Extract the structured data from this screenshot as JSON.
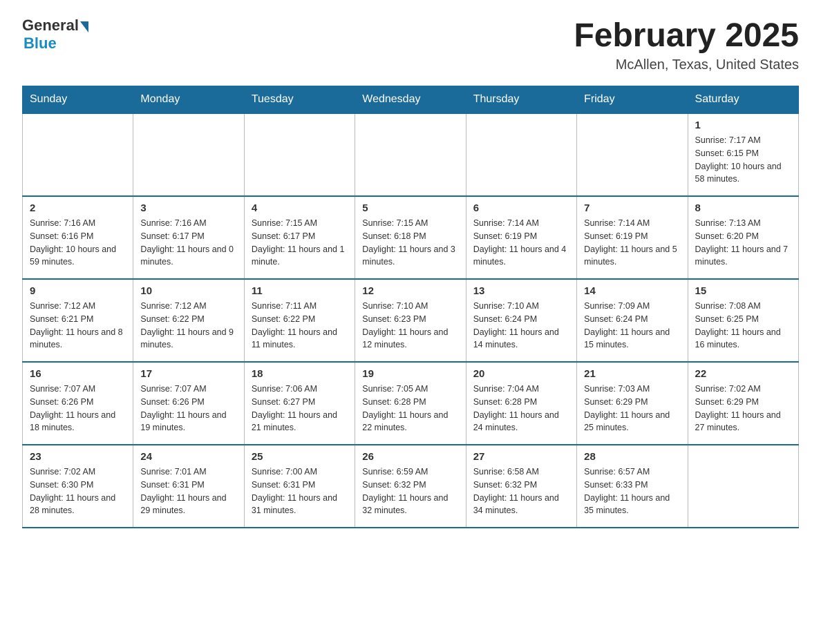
{
  "header": {
    "logo_general": "General",
    "logo_blue": "Blue",
    "title": "February 2025",
    "location": "McAllen, Texas, United States"
  },
  "weekdays": [
    "Sunday",
    "Monday",
    "Tuesday",
    "Wednesday",
    "Thursday",
    "Friday",
    "Saturday"
  ],
  "weeks": [
    [
      {
        "day": "",
        "info": ""
      },
      {
        "day": "",
        "info": ""
      },
      {
        "day": "",
        "info": ""
      },
      {
        "day": "",
        "info": ""
      },
      {
        "day": "",
        "info": ""
      },
      {
        "day": "",
        "info": ""
      },
      {
        "day": "1",
        "info": "Sunrise: 7:17 AM\nSunset: 6:15 PM\nDaylight: 10 hours and 58 minutes."
      }
    ],
    [
      {
        "day": "2",
        "info": "Sunrise: 7:16 AM\nSunset: 6:16 PM\nDaylight: 10 hours and 59 minutes."
      },
      {
        "day": "3",
        "info": "Sunrise: 7:16 AM\nSunset: 6:17 PM\nDaylight: 11 hours and 0 minutes."
      },
      {
        "day": "4",
        "info": "Sunrise: 7:15 AM\nSunset: 6:17 PM\nDaylight: 11 hours and 1 minute."
      },
      {
        "day": "5",
        "info": "Sunrise: 7:15 AM\nSunset: 6:18 PM\nDaylight: 11 hours and 3 minutes."
      },
      {
        "day": "6",
        "info": "Sunrise: 7:14 AM\nSunset: 6:19 PM\nDaylight: 11 hours and 4 minutes."
      },
      {
        "day": "7",
        "info": "Sunrise: 7:14 AM\nSunset: 6:19 PM\nDaylight: 11 hours and 5 minutes."
      },
      {
        "day": "8",
        "info": "Sunrise: 7:13 AM\nSunset: 6:20 PM\nDaylight: 11 hours and 7 minutes."
      }
    ],
    [
      {
        "day": "9",
        "info": "Sunrise: 7:12 AM\nSunset: 6:21 PM\nDaylight: 11 hours and 8 minutes."
      },
      {
        "day": "10",
        "info": "Sunrise: 7:12 AM\nSunset: 6:22 PM\nDaylight: 11 hours and 9 minutes."
      },
      {
        "day": "11",
        "info": "Sunrise: 7:11 AM\nSunset: 6:22 PM\nDaylight: 11 hours and 11 minutes."
      },
      {
        "day": "12",
        "info": "Sunrise: 7:10 AM\nSunset: 6:23 PM\nDaylight: 11 hours and 12 minutes."
      },
      {
        "day": "13",
        "info": "Sunrise: 7:10 AM\nSunset: 6:24 PM\nDaylight: 11 hours and 14 minutes."
      },
      {
        "day": "14",
        "info": "Sunrise: 7:09 AM\nSunset: 6:24 PM\nDaylight: 11 hours and 15 minutes."
      },
      {
        "day": "15",
        "info": "Sunrise: 7:08 AM\nSunset: 6:25 PM\nDaylight: 11 hours and 16 minutes."
      }
    ],
    [
      {
        "day": "16",
        "info": "Sunrise: 7:07 AM\nSunset: 6:26 PM\nDaylight: 11 hours and 18 minutes."
      },
      {
        "day": "17",
        "info": "Sunrise: 7:07 AM\nSunset: 6:26 PM\nDaylight: 11 hours and 19 minutes."
      },
      {
        "day": "18",
        "info": "Sunrise: 7:06 AM\nSunset: 6:27 PM\nDaylight: 11 hours and 21 minutes."
      },
      {
        "day": "19",
        "info": "Sunrise: 7:05 AM\nSunset: 6:28 PM\nDaylight: 11 hours and 22 minutes."
      },
      {
        "day": "20",
        "info": "Sunrise: 7:04 AM\nSunset: 6:28 PM\nDaylight: 11 hours and 24 minutes."
      },
      {
        "day": "21",
        "info": "Sunrise: 7:03 AM\nSunset: 6:29 PM\nDaylight: 11 hours and 25 minutes."
      },
      {
        "day": "22",
        "info": "Sunrise: 7:02 AM\nSunset: 6:29 PM\nDaylight: 11 hours and 27 minutes."
      }
    ],
    [
      {
        "day": "23",
        "info": "Sunrise: 7:02 AM\nSunset: 6:30 PM\nDaylight: 11 hours and 28 minutes."
      },
      {
        "day": "24",
        "info": "Sunrise: 7:01 AM\nSunset: 6:31 PM\nDaylight: 11 hours and 29 minutes."
      },
      {
        "day": "25",
        "info": "Sunrise: 7:00 AM\nSunset: 6:31 PM\nDaylight: 11 hours and 31 minutes."
      },
      {
        "day": "26",
        "info": "Sunrise: 6:59 AM\nSunset: 6:32 PM\nDaylight: 11 hours and 32 minutes."
      },
      {
        "day": "27",
        "info": "Sunrise: 6:58 AM\nSunset: 6:32 PM\nDaylight: 11 hours and 34 minutes."
      },
      {
        "day": "28",
        "info": "Sunrise: 6:57 AM\nSunset: 6:33 PM\nDaylight: 11 hours and 35 minutes."
      },
      {
        "day": "",
        "info": ""
      }
    ]
  ]
}
